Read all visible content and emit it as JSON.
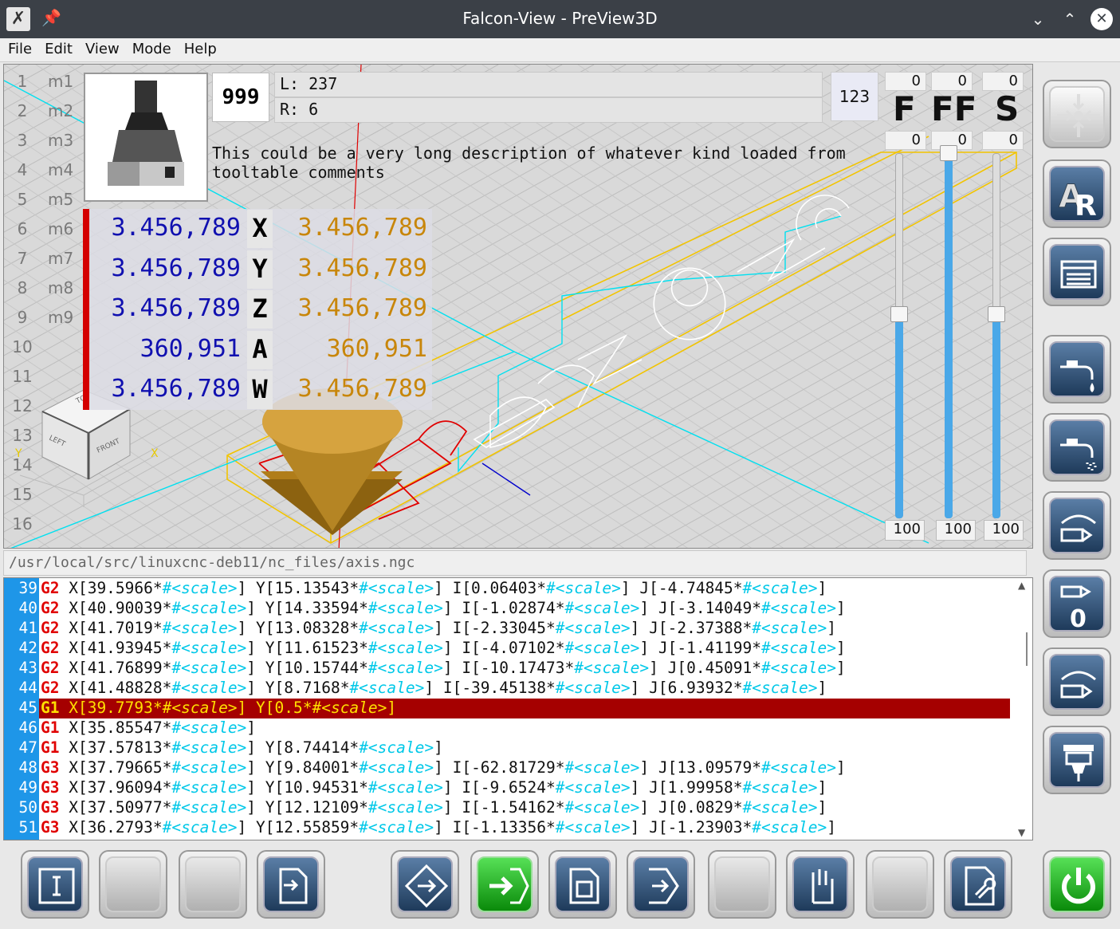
{
  "window": {
    "title": "Falcon-View - PreView3D",
    "buttons": {
      "minimize": "⌄",
      "maximize": "⌃",
      "close": "✕"
    }
  },
  "menu": [
    "File",
    "Edit",
    "View",
    "Mode",
    "Help"
  ],
  "preview": {
    "line_numbers": [
      "1",
      "2",
      "3",
      "4",
      "5",
      "6",
      "7",
      "8",
      "9",
      "10",
      "11",
      "12",
      "13",
      "14",
      "15",
      "16"
    ],
    "macros": [
      "m1",
      "m2",
      "m3",
      "m4",
      "m5",
      "m6",
      "m7",
      "m8",
      "m9"
    ],
    "tool": {
      "number": "999",
      "length": "L: 237",
      "radius": "R: 6",
      "description": "This could be a very long description of whatever kind loaded from tooltable comments"
    },
    "counter": "123",
    "dro": [
      {
        "left": "3.456,789",
        "axis": "X",
        "right": "3.456,789"
      },
      {
        "left": "3.456,789",
        "axis": "Y",
        "right": "3.456,789"
      },
      {
        "left": "3.456,789",
        "axis": "Z",
        "right": "3.456,789"
      },
      {
        "left": "360,951",
        "axis": "A",
        "right": "360,951"
      },
      {
        "left": "3.456,789",
        "axis": "W",
        "right": "3.456,789"
      }
    ],
    "overrides": [
      {
        "label": "F",
        "top": "0",
        "mid": "0",
        "bottom": "100",
        "level_percent": 56
      },
      {
        "label": "FF",
        "top": "0",
        "mid": "0",
        "bottom": "100",
        "level_percent": 100
      },
      {
        "label": "S",
        "top": "0",
        "mid": "0",
        "bottom": "100",
        "level_percent": 56
      }
    ],
    "viewcube": {
      "top": "TOP",
      "left": "LEFT",
      "front": "FRONT",
      "x": "X",
      "y": "Y"
    }
  },
  "file_path": "/usr/local/src/linuxcnc-deb11/nc_files/axis.ngc",
  "gcode": {
    "active_line": "45",
    "lines": [
      {
        "n": "39",
        "cmd": "G2",
        "parts": [
          " X[39.5966*",
          "#<scale>",
          "] Y[15.13543*",
          "#<scale>",
          "] I[0.06403*",
          "#<scale>",
          "] J[-4.74845*",
          "#<scale>",
          "]"
        ]
      },
      {
        "n": "40",
        "cmd": "G2",
        "parts": [
          " X[40.90039*",
          "#<scale>",
          "] Y[14.33594*",
          "#<scale>",
          "] I[-1.02874*",
          "#<scale>",
          "] J[-3.14049*",
          "#<scale>",
          "]"
        ]
      },
      {
        "n": "41",
        "cmd": "G2",
        "parts": [
          " X[41.7019*",
          "#<scale>",
          "] Y[13.08328*",
          "#<scale>",
          "] I[-2.33045*",
          "#<scale>",
          "] J[-2.37388*",
          "#<scale>",
          "]"
        ]
      },
      {
        "n": "42",
        "cmd": "G2",
        "parts": [
          " X[41.93945*",
          "#<scale>",
          "] Y[11.61523*",
          "#<scale>",
          "] I[-4.07102*",
          "#<scale>",
          "] J[-1.41199*",
          "#<scale>",
          "]"
        ]
      },
      {
        "n": "43",
        "cmd": "G2",
        "parts": [
          " X[41.76899*",
          "#<scale>",
          "] Y[10.15744*",
          "#<scale>",
          "] I[-10.17473*",
          "#<scale>",
          "] J[0.45091*",
          "#<scale>",
          "]"
        ]
      },
      {
        "n": "44",
        "cmd": "G2",
        "parts": [
          " X[41.48828*",
          "#<scale>",
          "] Y[8.7168*",
          "#<scale>",
          "] I[-39.45138*",
          "#<scale>",
          "] J[6.93932*",
          "#<scale>",
          "]"
        ]
      },
      {
        "n": "45",
        "cmd": "G1",
        "parts": [
          " X[39.7793*",
          "#<scale>",
          "] Y[0.5*",
          "#<scale>",
          "]"
        ]
      },
      {
        "n": "46",
        "cmd": "G1",
        "parts": [
          " X[35.85547*",
          "#<scale>",
          "]"
        ]
      },
      {
        "n": "47",
        "cmd": "G1",
        "parts": [
          " X[37.57813*",
          "#<scale>",
          "] Y[8.74414*",
          "#<scale>",
          "]"
        ]
      },
      {
        "n": "48",
        "cmd": "G3",
        "parts": [
          " X[37.79665*",
          "#<scale>",
          "] Y[9.84001*",
          "#<scale>",
          "] I[-62.81729*",
          "#<scale>",
          "] J[13.09579*",
          "#<scale>",
          "]"
        ]
      },
      {
        "n": "49",
        "cmd": "G3",
        "parts": [
          " X[37.96094*",
          "#<scale>",
          "] Y[10.94531*",
          "#<scale>",
          "] I[-9.6524*",
          "#<scale>",
          "] J[1.99958*",
          "#<scale>",
          "]"
        ]
      },
      {
        "n": "50",
        "cmd": "G3",
        "parts": [
          " X[37.50977*",
          "#<scale>",
          "] Y[12.12109*",
          "#<scale>",
          "] I[-1.54162*",
          "#<scale>",
          "] J[0.0829*",
          "#<scale>",
          "]"
        ]
      },
      {
        "n": "51",
        "cmd": "G3",
        "parts": [
          " X[36.2793*",
          "#<scale>",
          "] Y[12.55859*",
          "#<scale>",
          "] I[-1.13356*",
          "#<scale>",
          "] J[-1.23903*",
          "#<scale>",
          "]"
        ]
      }
    ]
  },
  "right_toolbar": [
    {
      "name": "home-all-button",
      "icon": "home-all-icon",
      "style": "light"
    },
    {
      "name": "auto-refresh-button",
      "icon": "ar-icon",
      "style": "dark",
      "text": "AR"
    },
    {
      "name": "file-manager-button",
      "icon": "file-manager-icon",
      "style": "dark"
    },
    {
      "name": "coolant-flood-button",
      "icon": "faucet-icon",
      "style": "dark"
    },
    {
      "name": "coolant-mist-button",
      "icon": "faucet-mist-icon",
      "style": "dark"
    },
    {
      "name": "touch-off-button",
      "icon": "probe-arc-icon",
      "style": "dark"
    },
    {
      "name": "zero-tool-button",
      "icon": "probe-zero-icon",
      "style": "dark",
      "text": "0"
    },
    {
      "name": "measure-button",
      "icon": "probe-arc-icon",
      "style": "dark"
    },
    {
      "name": "tool-change-button",
      "icon": "tool-holder-icon",
      "style": "dark"
    }
  ],
  "bottom_toolbar": [
    {
      "name": "info-button",
      "icon": "info-frame-icon",
      "style": "dark"
    },
    {
      "name": "blank-button-1",
      "icon": "",
      "style": "blank"
    },
    {
      "name": "blank-button-2",
      "icon": "",
      "style": "blank"
    },
    {
      "name": "run-file-button",
      "icon": "run-file-icon",
      "style": "dark"
    },
    {
      "name": "jog-mode-button",
      "icon": "diamond-arrow-icon",
      "style": "dark"
    },
    {
      "name": "auto-mode-button",
      "icon": "enter-arrow-icon",
      "style": "green"
    },
    {
      "name": "program-button",
      "icon": "program-file-icon",
      "style": "dark"
    },
    {
      "name": "mdi-button",
      "icon": "mdi-arrow-icon",
      "style": "dark"
    },
    {
      "name": "blank-button-3",
      "icon": "",
      "style": "blank"
    },
    {
      "name": "manual-button",
      "icon": "hand-icon",
      "style": "dark"
    },
    {
      "name": "blank-button-4",
      "icon": "",
      "style": "blank"
    },
    {
      "name": "settings-file-button",
      "icon": "file-wrench-icon",
      "style": "dark"
    },
    {
      "name": "power-button",
      "icon": "power-icon",
      "style": "green"
    }
  ],
  "colors": {
    "titlebar": "#3b4047",
    "gutter": "#1e96e8",
    "active_line": "#a50000",
    "active_text": "#ffe000",
    "gcode_command": "#e00000",
    "gcode_variable": "#00c8e8",
    "dro_absolute": "#1010b0",
    "dro_relative": "#c8860a",
    "slider_fill": "#4aa8e8",
    "power_green": "#1cb81c"
  }
}
